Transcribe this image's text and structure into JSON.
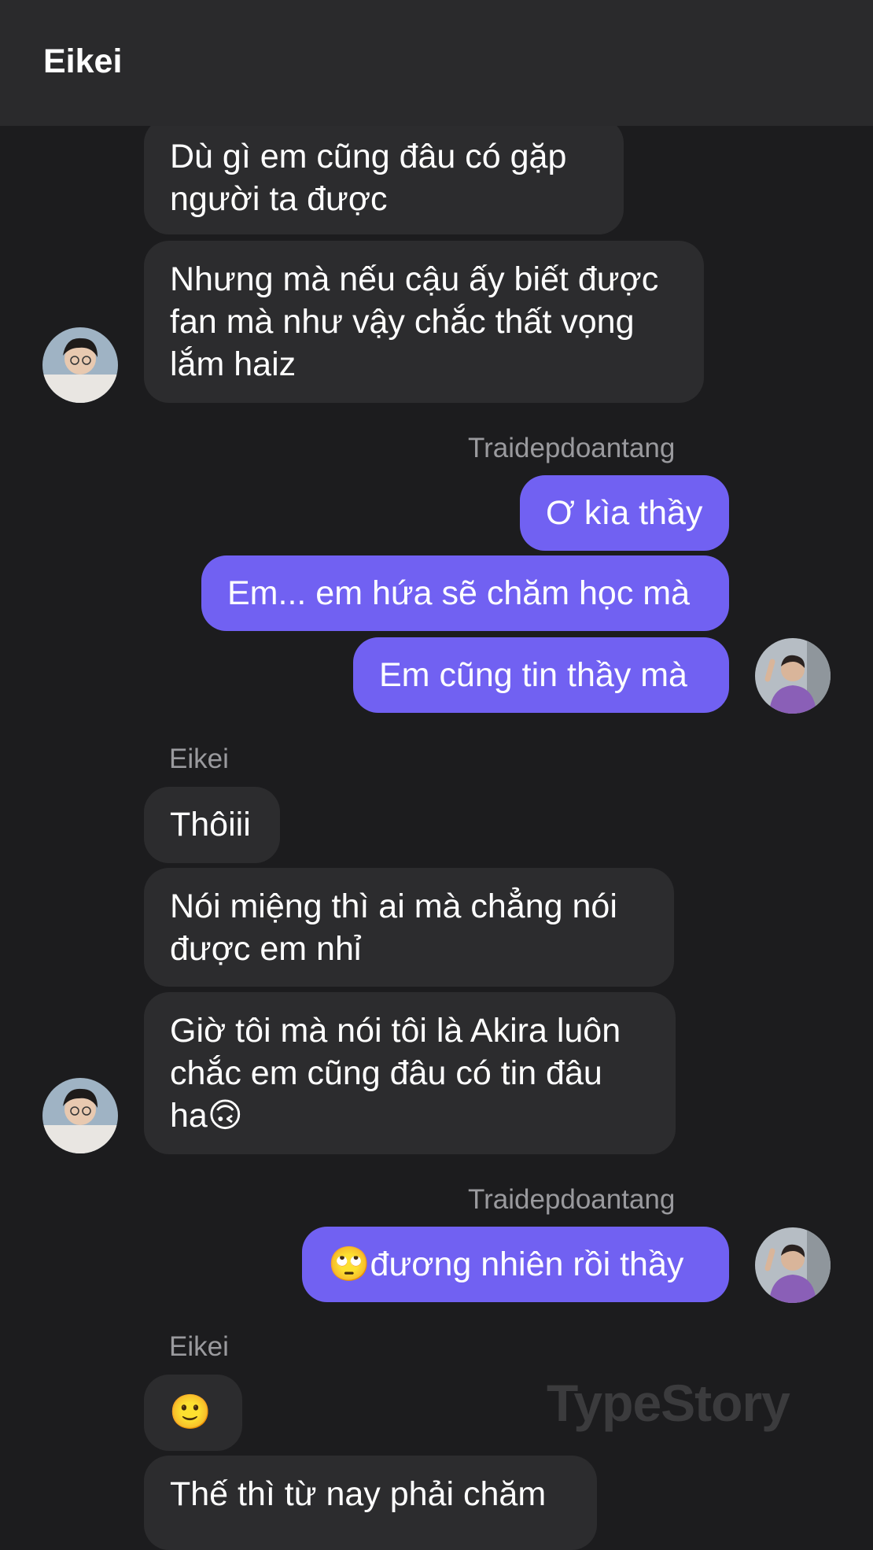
{
  "header": {
    "title": "Eikei"
  },
  "senders": {
    "me": "Traidepdoantang",
    "other": "Eikei"
  },
  "messages": {
    "m1": "Dù gì em cũng đâu có gặp\nngười ta được",
    "m2": "Nhưng mà nếu cậu ấy biết được\nfan mà như vậy chắc thất vọng\nlắm haiz",
    "m3": "Ơ kìa thầy",
    "m4": "Em... em hứa sẽ chăm học mà",
    "m5": "Em cũng tin thầy mà",
    "m6": "Thôiii",
    "m7": "Nói miệng thì ai mà chẳng nói\nđược em nhỉ",
    "m8": "Giờ tôi mà nói tôi là Akira luôn\nchắc em cũng đâu có tin đâu\nha🙃",
    "m9": "🙄đương nhiên rồi thầy",
    "m10": "🙂",
    "m11": "Thế thì từ nay phải chăm"
  },
  "watermark": "TypeStory",
  "colors": {
    "outgoing": "#7161f2",
    "incoming": "#2c2c2e",
    "background": "#1c1c1e",
    "header": "#2a2a2c"
  }
}
